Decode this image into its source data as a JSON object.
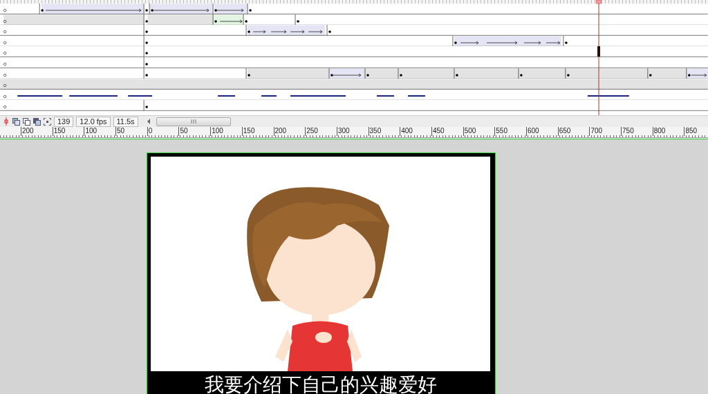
{
  "toolbar": {
    "current_frame": "139",
    "frame_rate": "12.0 fps",
    "elapsed_time": "11.5s"
  },
  "ruler": {
    "labels": [
      "200",
      "150",
      "100",
      "50",
      "0",
      "50",
      "100",
      "150",
      "200",
      "250",
      "300",
      "350",
      "400",
      "450",
      "500",
      "550",
      "600",
      "650",
      "700",
      "750",
      "800",
      "850"
    ]
  },
  "stage": {
    "subtitle": "我要介绍下自己的兴趣爱好"
  }
}
